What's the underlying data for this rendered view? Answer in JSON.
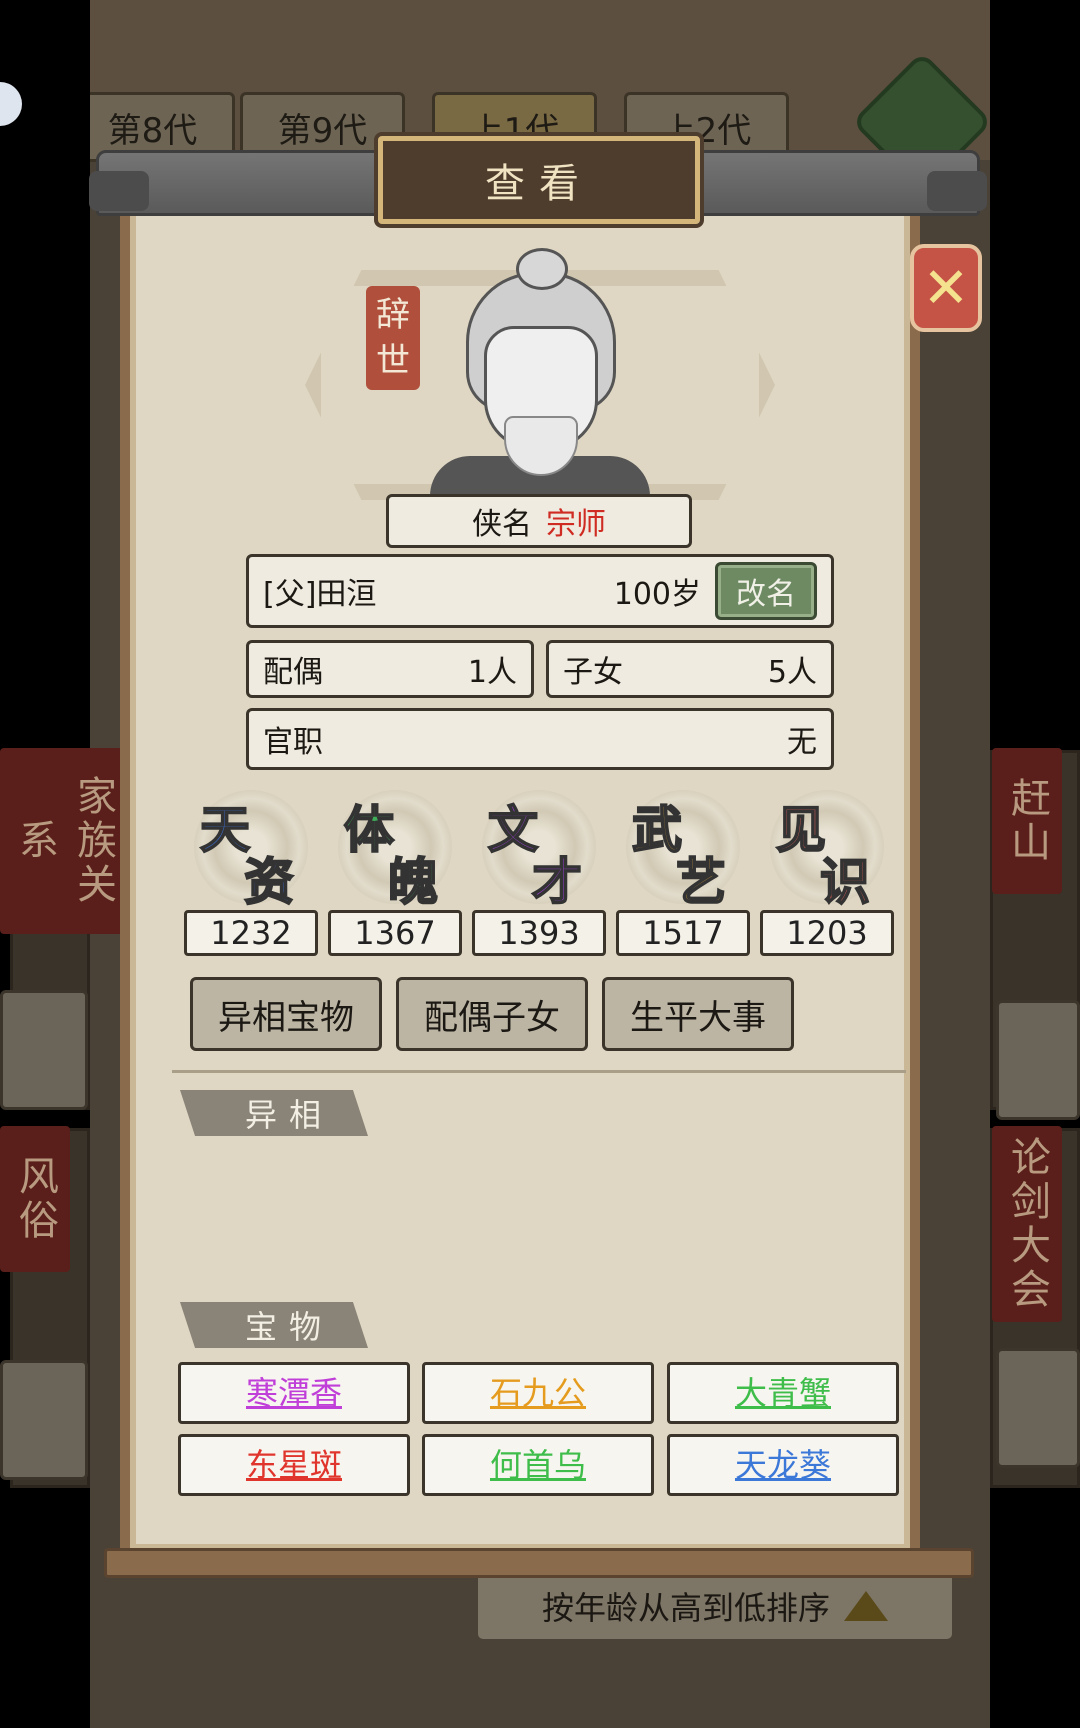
{
  "background": {
    "tabs": [
      {
        "label": "第8代"
      },
      {
        "label": "第9代"
      },
      {
        "label": "上1代"
      },
      {
        "label": "上2代"
      }
    ],
    "left_labels": [
      "家族关系",
      "风俗"
    ],
    "right_labels": [
      "赶山",
      "论剑大会"
    ],
    "sort_label": "按年龄从高到低排序"
  },
  "panel": {
    "title": "查看",
    "status_tag": "辞世",
    "alias_label": "侠名",
    "alias_value": "宗师",
    "parent_name": "[父]田洹",
    "age": "100岁",
    "rename_label": "改名",
    "spouse_label": "配偶",
    "spouse_count": "1人",
    "children_label": "子女",
    "children_count": "5人",
    "office_label": "官职",
    "office_value": "无"
  },
  "stats": [
    {
      "c1": "天",
      "c2": "资",
      "value": "1232",
      "color": "#3c6fd8"
    },
    {
      "c1": "体",
      "c2": "魄",
      "value": "1367",
      "color": "#3fae5a"
    },
    {
      "c1": "文",
      "c2": "才",
      "value": "1393",
      "color": "#9b3fd4"
    },
    {
      "c1": "武",
      "c2": "艺",
      "value": "1517",
      "color": "#e0a93a"
    },
    {
      "c1": "见",
      "c2": "识",
      "value": "1203",
      "color": "#e2635a"
    }
  ],
  "tabs": [
    {
      "label": "异相宝物",
      "active": true
    },
    {
      "label": "配偶子女",
      "active": false
    },
    {
      "label": "生平大事",
      "active": false
    }
  ],
  "sections": {
    "aberration": "异相",
    "treasures": "宝物"
  },
  "treasures": [
    {
      "name": "寒潭香",
      "color": "#c03fd8"
    },
    {
      "name": "石九公",
      "color": "#e49b1e"
    },
    {
      "name": "大青蟹",
      "color": "#3fbd4a"
    },
    {
      "name": "东星斑",
      "color": "#e0352c"
    },
    {
      "name": "何首乌",
      "color": "#3fbd4a"
    },
    {
      "name": "天龙葵",
      "color": "#3b78d8"
    }
  ]
}
